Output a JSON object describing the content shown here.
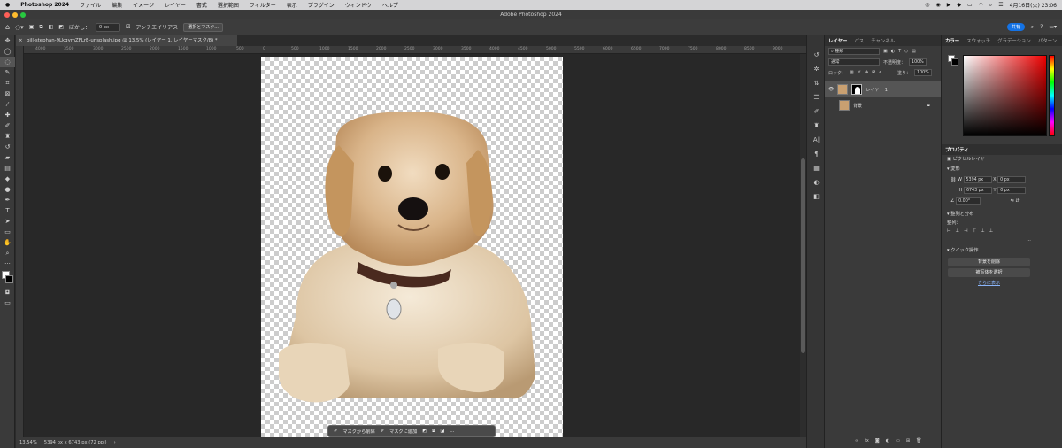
{
  "menubar": {
    "app": "Photoshop 2024",
    "items": [
      "ファイル",
      "編集",
      "イメージ",
      "レイヤー",
      "書式",
      "選択範囲",
      "フィルター",
      "表示",
      "プラグイン",
      "ウィンドウ",
      "ヘルプ"
    ],
    "clock": "4月16日(火) 23:06"
  },
  "window": {
    "title": "Adobe Photoshop 2024"
  },
  "options": {
    "feather_label": "ぼかし：",
    "feather_value": "0 px",
    "antialias_label": "アンチエイリアス",
    "select_mask_button": "選択とマスク...",
    "share_button": "共有"
  },
  "document": {
    "tab": "bill-stephan-9LkqymZFLrE-unsplash.jpg @ 13.5% (レイヤー 1, レイヤーマスク/8) *",
    "ruler_labels": [
      "4000",
      "3500",
      "3000",
      "2500",
      "2000",
      "1500",
      "1000",
      "500",
      "0",
      "500",
      "1000",
      "1500",
      "2000",
      "2500",
      "3000",
      "3500",
      "4000",
      "4500",
      "5000",
      "5500",
      "6000",
      "6500",
      "7000",
      "7500",
      "8000",
      "8500",
      "9000"
    ]
  },
  "status": {
    "zoom": "13.54%",
    "size": "5394 px x 6743 px (72 ppi)"
  },
  "taskbar": {
    "subtract": "マスクから削除",
    "add": "マスクに追加",
    "more": "..."
  },
  "layers_panel": {
    "tabs": [
      "レイヤー",
      "パス",
      "チャンネル"
    ],
    "filter": "種類",
    "blend_mode": "通常",
    "opacity_label": "不透明度：",
    "opacity": "100%",
    "lock_label": "ロック：",
    "fill_label": "塗り：",
    "fill": "100%",
    "layers": [
      {
        "name": "レイヤー 1",
        "selected": true
      },
      {
        "name": "背景",
        "selected": false
      }
    ]
  },
  "color_panel": {
    "tabs": [
      "カラー",
      "スウォッチ",
      "グラデーション",
      "パターン"
    ]
  },
  "properties": {
    "title": "プロパティ",
    "type": "ピクセルレイヤー",
    "transform_label": "変形",
    "w_label": "W",
    "w": "5394 px",
    "h_label": "H",
    "h": "6743 px",
    "x_label": "X",
    "x": "0 px",
    "y_label": "Y",
    "y": "0 px",
    "angle": "0.00°",
    "align_label": "整列と分布",
    "align_sub": "整列：",
    "quick_label": "クイック操作",
    "remove_bg": "背景を削除",
    "select_subject": "被写体を選択",
    "more": "さらに表示"
  }
}
